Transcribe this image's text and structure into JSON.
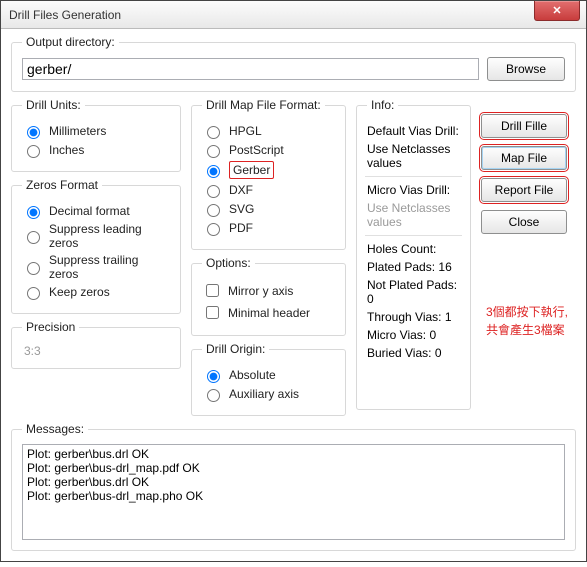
{
  "window": {
    "title": "Drill Files Generation",
    "close_glyph": "✕"
  },
  "output": {
    "legend": "Output directory:",
    "value": "gerber/",
    "browse_label": "Browse"
  },
  "drill_units": {
    "legend": "Drill Units:",
    "options": [
      "Millimeters",
      "Inches"
    ],
    "selected": "Millimeters"
  },
  "zeros_format": {
    "legend": "Zeros Format",
    "options": [
      "Decimal format",
      "Suppress leading zeros",
      "Suppress trailing zeros",
      "Keep zeros"
    ],
    "selected": "Decimal format"
  },
  "precision": {
    "legend": "Precision",
    "value": "3:3"
  },
  "map_format": {
    "legend": "Drill Map File Format:",
    "options": [
      "HPGL",
      "PostScript",
      "Gerber",
      "DXF",
      "SVG",
      "PDF"
    ],
    "selected": "Gerber"
  },
  "options_group": {
    "legend": "Options:",
    "items": [
      {
        "label": "Mirror y axis",
        "checked": false
      },
      {
        "label": "Minimal header",
        "checked": false
      }
    ]
  },
  "drill_origin": {
    "legend": "Drill Origin:",
    "options": [
      "Absolute",
      "Auxiliary axis"
    ],
    "selected": "Absolute"
  },
  "info": {
    "legend": "Info:",
    "default_vias": {
      "label": "Default Vias Drill:",
      "sub": "Use Netclasses values"
    },
    "micro_vias": {
      "label": "Micro Vias Drill:",
      "sub": "Use Netclasses values",
      "sub_muted": true
    },
    "holes_legend": "Holes Count:",
    "holes": [
      {
        "label": "Plated Pads:",
        "value": "16"
      },
      {
        "label": "Not Plated Pads:",
        "value": "0"
      },
      {
        "label": "Through Vias:",
        "value": "1"
      },
      {
        "label": "Micro Vias:",
        "value": "0"
      },
      {
        "label": "Buried Vias:",
        "value": "0"
      }
    ]
  },
  "buttons": {
    "drill": "Drill Fille",
    "map": "Map File",
    "report": "Report File",
    "close": "Close"
  },
  "annotation": {
    "line1": "3個都按下執行,",
    "line2": "共會產生3檔案"
  },
  "messages": {
    "legend": "Messages:",
    "lines": [
      "Plot: gerber\\bus.drl OK",
      "Plot: gerber\\bus-drl_map.pdf OK",
      "Plot: gerber\\bus.drl OK",
      "Plot: gerber\\bus-drl_map.pho OK"
    ]
  }
}
